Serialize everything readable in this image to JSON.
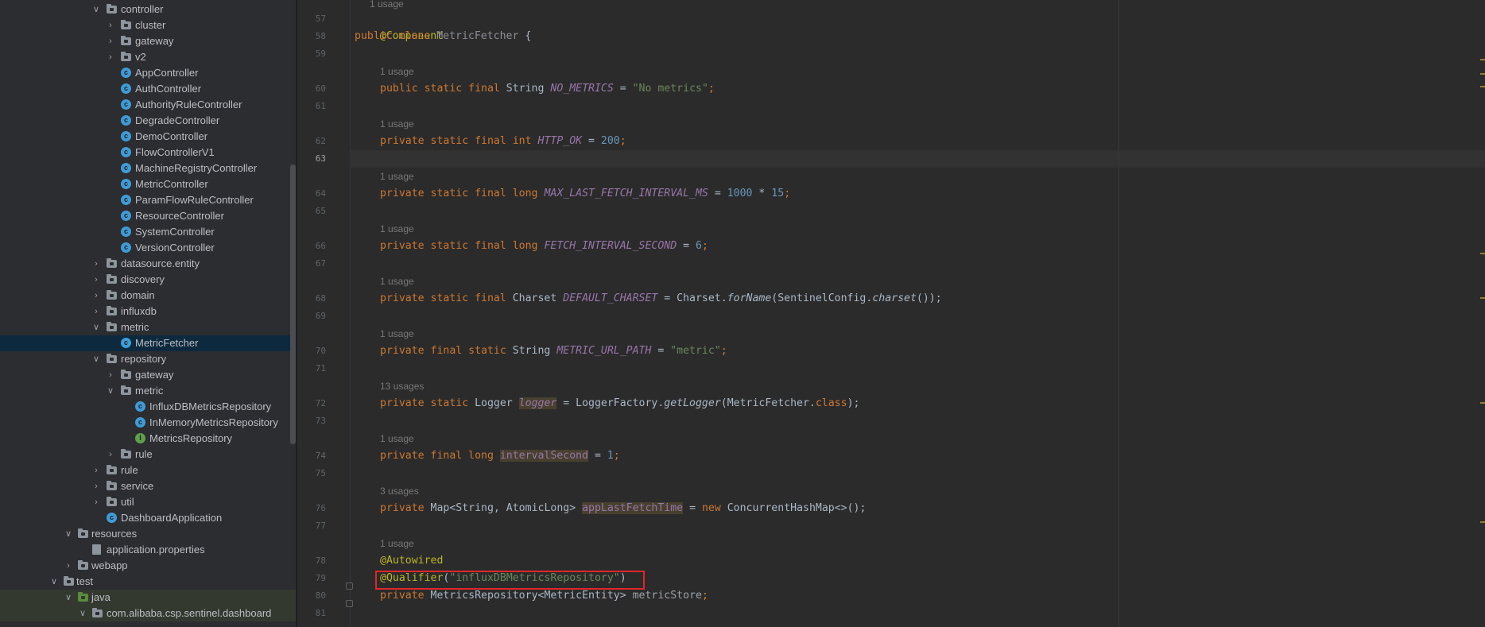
{
  "project_tree": {
    "items": [
      {
        "label": "controller",
        "depth": 1,
        "type": "folder",
        "expanded": true
      },
      {
        "label": "cluster",
        "depth": 2,
        "type": "folder",
        "expanded": false
      },
      {
        "label": "gateway",
        "depth": 2,
        "type": "folder",
        "expanded": false
      },
      {
        "label": "v2",
        "depth": 2,
        "type": "folder",
        "expanded": false
      },
      {
        "label": "AppController",
        "depth": 2,
        "type": "class"
      },
      {
        "label": "AuthController",
        "depth": 2,
        "type": "class"
      },
      {
        "label": "AuthorityRuleController",
        "depth": 2,
        "type": "class"
      },
      {
        "label": "DegradeController",
        "depth": 2,
        "type": "class"
      },
      {
        "label": "DemoController",
        "depth": 2,
        "type": "class"
      },
      {
        "label": "FlowControllerV1",
        "depth": 2,
        "type": "class"
      },
      {
        "label": "MachineRegistryController",
        "depth": 2,
        "type": "class"
      },
      {
        "label": "MetricController",
        "depth": 2,
        "type": "class"
      },
      {
        "label": "ParamFlowRuleController",
        "depth": 2,
        "type": "class"
      },
      {
        "label": "ResourceController",
        "depth": 2,
        "type": "class"
      },
      {
        "label": "SystemController",
        "depth": 2,
        "type": "class"
      },
      {
        "label": "VersionController",
        "depth": 2,
        "type": "class"
      },
      {
        "label": "datasource.entity",
        "depth": 1,
        "type": "folder",
        "expanded": false
      },
      {
        "label": "discovery",
        "depth": 1,
        "type": "folder",
        "expanded": false
      },
      {
        "label": "domain",
        "depth": 1,
        "type": "folder",
        "expanded": false
      },
      {
        "label": "influxdb",
        "depth": 1,
        "type": "folder",
        "expanded": false
      },
      {
        "label": "metric",
        "depth": 1,
        "type": "folder",
        "expanded": true
      },
      {
        "label": "MetricFetcher",
        "depth": 2,
        "type": "class",
        "selected": true
      },
      {
        "label": "repository",
        "depth": 1,
        "type": "folder",
        "expanded": true
      },
      {
        "label": "gateway",
        "depth": 2,
        "type": "folder",
        "expanded": false
      },
      {
        "label": "metric",
        "depth": 2,
        "type": "folder",
        "expanded": true
      },
      {
        "label": "InfluxDBMetricsRepository",
        "depth": 3,
        "type": "class"
      },
      {
        "label": "InMemoryMetricsRepository",
        "depth": 3,
        "type": "class"
      },
      {
        "label": "MetricsRepository",
        "depth": 3,
        "type": "interface"
      },
      {
        "label": "rule",
        "depth": 2,
        "type": "folder",
        "expanded": false
      },
      {
        "label": "rule",
        "depth": 1,
        "type": "folder",
        "expanded": false
      },
      {
        "label": "service",
        "depth": 1,
        "type": "folder",
        "expanded": false
      },
      {
        "label": "util",
        "depth": 1,
        "type": "folder",
        "expanded": false
      },
      {
        "label": "DashboardApplication",
        "depth": 1,
        "type": "class"
      },
      {
        "label": "resources",
        "depth": -1,
        "type": "folder",
        "expanded": true
      },
      {
        "label": "application.properties",
        "depth": 0,
        "type": "properties"
      },
      {
        "label": "webapp",
        "depth": -1,
        "type": "folder",
        "expanded": false
      },
      {
        "label": "test",
        "depth": -3,
        "type": "folder",
        "expanded": true
      },
      {
        "label": "java",
        "depth": -1,
        "type": "folder-green",
        "expanded": true
      },
      {
        "label": "com.alibaba.csp.sentinel.dashboard",
        "depth": 0,
        "type": "folder",
        "expanded": true
      }
    ]
  },
  "editor": {
    "top_hint": "1 usage",
    "line_numbers": [
      "57",
      "58",
      "59",
      "60",
      "61",
      "62",
      "63",
      "64",
      "65",
      "66",
      "67",
      "68",
      "69",
      "70",
      "71",
      "72",
      "73",
      "74",
      "75",
      "76",
      "77",
      "78",
      "79",
      "80",
      "81"
    ],
    "current_line": "63",
    "hints": {
      "h60": "1 usage",
      "h62": "1 usage",
      "h64": "1 usage",
      "h66": "1 usage",
      "h68": "1 usage",
      "h70": "1 usage",
      "h72": "13 usages",
      "h74": "1 usage",
      "h76": "3 usages",
      "h78": "1 usage"
    },
    "code": {
      "l57_ann": "@Component",
      "l58_kw": "public class ",
      "l58_name": "MetricFetcher",
      "l58_rest": " {",
      "l60_kw": "public static final ",
      "l60_type": "String ",
      "l60_field": "NO_METRICS",
      "l60_eq": " = ",
      "l60_str": "\"No metrics\"",
      "l60_end": ";",
      "l62_kw": "private static final int ",
      "l62_field": "HTTP_OK",
      "l62_eq": " = ",
      "l62_num": "200",
      "l62_end": ";",
      "l64_kw": "private static final long ",
      "l64_field": "MAX_LAST_FETCH_INTERVAL_MS",
      "l64_eq": " = ",
      "l64_num1": "1000",
      "l64_op": " * ",
      "l64_num2": "15",
      "l64_end": ";",
      "l66_kw": "private static final long ",
      "l66_field": "FETCH_INTERVAL_SECOND",
      "l66_eq": " = ",
      "l66_num": "6",
      "l66_end": ";",
      "l68_kw": "private static final ",
      "l68_type": "Charset ",
      "l68_field": "DEFAULT_CHARSET",
      "l68_mid": " = Charset.",
      "l68_m1": "forName",
      "l68_mid2": "(SentinelConfig.",
      "l68_m2": "charset",
      "l68_end": "());",
      "l70_kw": "private final static ",
      "l70_type": "String ",
      "l70_field": "METRIC_URL_PATH",
      "l70_eq": " = ",
      "l70_str": "\"metric\"",
      "l70_end": ";",
      "l72_kw": "private static ",
      "l72_type": "Logger ",
      "l72_field": "logger",
      "l72_mid": " = LoggerFactory.",
      "l72_m": "getLogger",
      "l72_mid2": "(MetricFetcher.",
      "l72_kw2": "class",
      "l72_end": ");",
      "l74_kw": "private final long ",
      "l74_field": "intervalSecond",
      "l74_eq": " = ",
      "l74_num": "1",
      "l74_end": ";",
      "l76_kw": "private ",
      "l76_type": "Map<String, AtomicLong> ",
      "l76_field": "appLastFetchTime",
      "l76_eq": " = ",
      "l76_kw2": "new ",
      "l76_end": "ConcurrentHashMap<>();",
      "l78_ann": "@Autowired",
      "l79_ann": "@Qualifier",
      "l79_open": "(",
      "l79_str": "\"influxDBMetricsRepository\"",
      "l79_close": ")",
      "l80_kw": "private ",
      "l80_type": "MetricsRepository<MetricEntity> ",
      "l80_field": "metricStore",
      "l80_end": ";"
    }
  },
  "colors": {
    "keyword": "#cc7832",
    "annotation": "#bbb529",
    "string": "#6a8759",
    "number": "#6897bb",
    "field": "#9876aa",
    "highlight_box": "#e0262b"
  }
}
